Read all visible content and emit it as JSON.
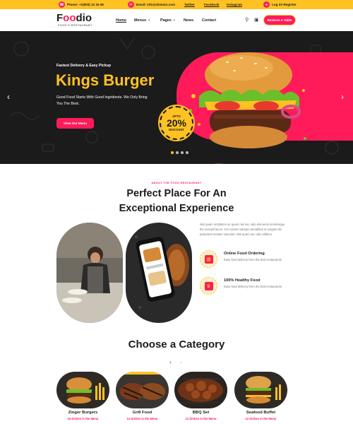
{
  "topbar": {
    "phone": "Phone: +1(900) 12 34 56",
    "email": "Email: info@domain.com",
    "social": [
      "Twitter",
      "Facebook",
      "Instagram"
    ],
    "login": "Log in/ Register"
  },
  "header": {
    "logo_main_1": "F",
    "logo_main_oo": "oo",
    "logo_main_2": "dio",
    "logo_sub": "FOOD'S RESTAURANT",
    "nav": [
      {
        "label": "Home",
        "active": true
      },
      {
        "label": "Menus",
        "dropdown": true
      },
      {
        "label": "Pages",
        "dropdown": true
      },
      {
        "label": "News"
      },
      {
        "label": "Contact"
      }
    ],
    "reserve_label": "Reserve A Table"
  },
  "hero": {
    "kicker": "Fastest Delivery & Easy Pickup",
    "title": "Kings Burger",
    "description": "Good Food Starts With Good Ingridients. We Only Bring You The Best.",
    "cta": "View Our Menu",
    "badge_top": "UPTO",
    "badge_value": "20%",
    "badge_bottom": "DISCOUNT",
    "slides": 4,
    "active_slide": 1
  },
  "about": {
    "kicker": "ABOUT THE FOOD RESTAURANT",
    "title_line1": "Perfect Place For An",
    "title_line2": "Exceptional Experience",
    "text": "Nisl quam restitution ac quam nisi nec odio elementu scelerisque the suscipit lacus. Orci varius natoque penatibus et magnis dis parturient montes nascetur. Nisl quam nec odio elitbine.",
    "features": [
      {
        "title": "Online Food Ordering",
        "desc": "Easy food delivery from the best restaurants"
      },
      {
        "title": "100% Healthy Food",
        "desc": "Easy food delivery from the best restaurants."
      }
    ]
  },
  "category": {
    "title": "Choose a Category",
    "items": [
      {
        "name": "Zinger Burgers",
        "sub": "04 Dishes in the Menu"
      },
      {
        "name": "Grill Food",
        "sub": "12 Dishes in the Menu"
      },
      {
        "name": "BBQ Set",
        "sub": "12 Dishes in the Menu"
      },
      {
        "name": "Seafood Buffet",
        "sub": "12 Dishes in the Menu"
      }
    ]
  },
  "colors": {
    "brand_yellow": "#ffc222",
    "brand_pink": "#ff1b5a",
    "dark": "#1b1b1b"
  }
}
